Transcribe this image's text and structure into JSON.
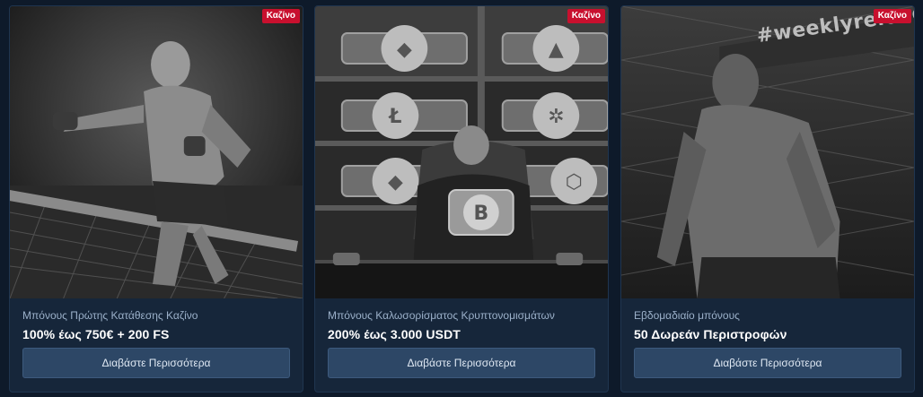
{
  "cards": [
    {
      "badge": "Καζίνο",
      "subtitle": "Μπόνους Πρώτης Κατάθεσης Καζίνο",
      "title": "100% έως 750€ + 200 FS",
      "button": "Διαβάστε Περισσότερα"
    },
    {
      "badge": "Καζίνο",
      "subtitle": "Μπόνους Καλωσορίσματος Κρυπτονομισμάτων",
      "title": "200% έως 3.000 USDT",
      "button": "Διαβάστε Περισσότερα"
    },
    {
      "badge": "Καζίνο",
      "subtitle": "Εβδομαδιαίο μπόνους",
      "title": "50 Δωρεάν Περιστροφών",
      "button": "Διαβάστε Περισσότερα",
      "image_text": "#weeklyreload"
    }
  ],
  "colors": {
    "page_bg": "#0e1a2a",
    "card_bg": "#16263a",
    "badge": "#c8102e",
    "button": "#2d4766"
  }
}
